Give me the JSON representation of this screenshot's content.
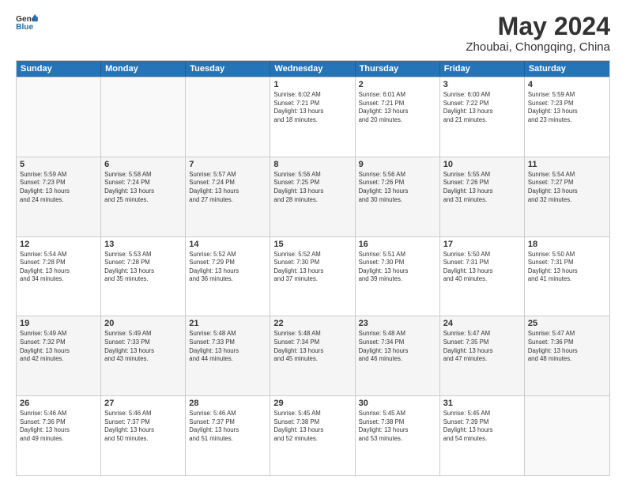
{
  "header": {
    "logo_line1": "General",
    "logo_line2": "Blue",
    "month": "May 2024",
    "location": "Zhoubai, Chongqing, China"
  },
  "weekdays": [
    "Sunday",
    "Monday",
    "Tuesday",
    "Wednesday",
    "Thursday",
    "Friday",
    "Saturday"
  ],
  "rows": [
    {
      "cells": [
        {
          "day": "",
          "info": ""
        },
        {
          "day": "",
          "info": ""
        },
        {
          "day": "",
          "info": ""
        },
        {
          "day": "1",
          "info": "Sunrise: 6:02 AM\nSunset: 7:21 PM\nDaylight: 13 hours\nand 18 minutes."
        },
        {
          "day": "2",
          "info": "Sunrise: 6:01 AM\nSunset: 7:21 PM\nDaylight: 13 hours\nand 20 minutes."
        },
        {
          "day": "3",
          "info": "Sunrise: 6:00 AM\nSunset: 7:22 PM\nDaylight: 13 hours\nand 21 minutes."
        },
        {
          "day": "4",
          "info": "Sunrise: 5:59 AM\nSunset: 7:23 PM\nDaylight: 13 hours\nand 23 minutes."
        }
      ]
    },
    {
      "cells": [
        {
          "day": "5",
          "info": "Sunrise: 5:59 AM\nSunset: 7:23 PM\nDaylight: 13 hours\nand 24 minutes."
        },
        {
          "day": "6",
          "info": "Sunrise: 5:58 AM\nSunset: 7:24 PM\nDaylight: 13 hours\nand 25 minutes."
        },
        {
          "day": "7",
          "info": "Sunrise: 5:57 AM\nSunset: 7:24 PM\nDaylight: 13 hours\nand 27 minutes."
        },
        {
          "day": "8",
          "info": "Sunrise: 5:56 AM\nSunset: 7:25 PM\nDaylight: 13 hours\nand 28 minutes."
        },
        {
          "day": "9",
          "info": "Sunrise: 5:56 AM\nSunset: 7:26 PM\nDaylight: 13 hours\nand 30 minutes."
        },
        {
          "day": "10",
          "info": "Sunrise: 5:55 AM\nSunset: 7:26 PM\nDaylight: 13 hours\nand 31 minutes."
        },
        {
          "day": "11",
          "info": "Sunrise: 5:54 AM\nSunset: 7:27 PM\nDaylight: 13 hours\nand 32 minutes."
        }
      ]
    },
    {
      "cells": [
        {
          "day": "12",
          "info": "Sunrise: 5:54 AM\nSunset: 7:28 PM\nDaylight: 13 hours\nand 34 minutes."
        },
        {
          "day": "13",
          "info": "Sunrise: 5:53 AM\nSunset: 7:28 PM\nDaylight: 13 hours\nand 35 minutes."
        },
        {
          "day": "14",
          "info": "Sunrise: 5:52 AM\nSunset: 7:29 PM\nDaylight: 13 hours\nand 36 minutes."
        },
        {
          "day": "15",
          "info": "Sunrise: 5:52 AM\nSunset: 7:30 PM\nDaylight: 13 hours\nand 37 minutes."
        },
        {
          "day": "16",
          "info": "Sunrise: 5:51 AM\nSunset: 7:30 PM\nDaylight: 13 hours\nand 39 minutes."
        },
        {
          "day": "17",
          "info": "Sunrise: 5:50 AM\nSunset: 7:31 PM\nDaylight: 13 hours\nand 40 minutes."
        },
        {
          "day": "18",
          "info": "Sunrise: 5:50 AM\nSunset: 7:31 PM\nDaylight: 13 hours\nand 41 minutes."
        }
      ]
    },
    {
      "cells": [
        {
          "day": "19",
          "info": "Sunrise: 5:49 AM\nSunset: 7:32 PM\nDaylight: 13 hours\nand 42 minutes."
        },
        {
          "day": "20",
          "info": "Sunrise: 5:49 AM\nSunset: 7:33 PM\nDaylight: 13 hours\nand 43 minutes."
        },
        {
          "day": "21",
          "info": "Sunrise: 5:48 AM\nSunset: 7:33 PM\nDaylight: 13 hours\nand 44 minutes."
        },
        {
          "day": "22",
          "info": "Sunrise: 5:48 AM\nSunset: 7:34 PM\nDaylight: 13 hours\nand 45 minutes."
        },
        {
          "day": "23",
          "info": "Sunrise: 5:48 AM\nSunset: 7:34 PM\nDaylight: 13 hours\nand 46 minutes."
        },
        {
          "day": "24",
          "info": "Sunrise: 5:47 AM\nSunset: 7:35 PM\nDaylight: 13 hours\nand 47 minutes."
        },
        {
          "day": "25",
          "info": "Sunrise: 5:47 AM\nSunset: 7:36 PM\nDaylight: 13 hours\nand 48 minutes."
        }
      ]
    },
    {
      "cells": [
        {
          "day": "26",
          "info": "Sunrise: 5:46 AM\nSunset: 7:36 PM\nDaylight: 13 hours\nand 49 minutes."
        },
        {
          "day": "27",
          "info": "Sunrise: 5:46 AM\nSunset: 7:37 PM\nDaylight: 13 hours\nand 50 minutes."
        },
        {
          "day": "28",
          "info": "Sunrise: 5:46 AM\nSunset: 7:37 PM\nDaylight: 13 hours\nand 51 minutes."
        },
        {
          "day": "29",
          "info": "Sunrise: 5:45 AM\nSunset: 7:38 PM\nDaylight: 13 hours\nand 52 minutes."
        },
        {
          "day": "30",
          "info": "Sunrise: 5:45 AM\nSunset: 7:38 PM\nDaylight: 13 hours\nand 53 minutes."
        },
        {
          "day": "31",
          "info": "Sunrise: 5:45 AM\nSunset: 7:39 PM\nDaylight: 13 hours\nand 54 minutes."
        },
        {
          "day": "",
          "info": ""
        }
      ]
    }
  ]
}
